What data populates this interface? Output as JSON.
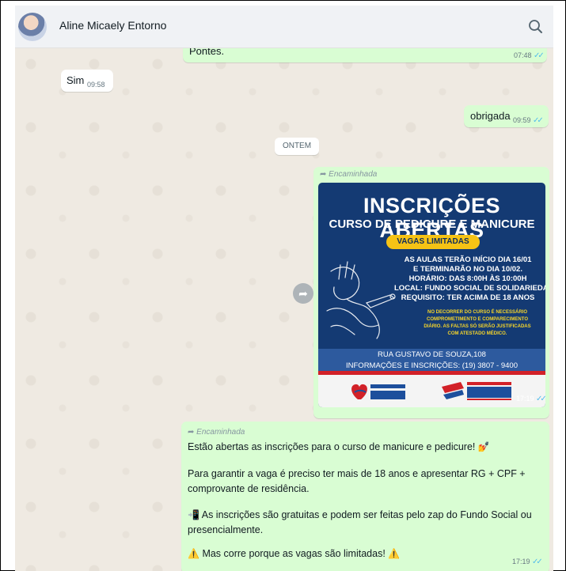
{
  "header": {
    "contact_name": "Aline Micaely Entorno"
  },
  "icons": {
    "avatar": "contact-avatar",
    "search": "search-icon",
    "forward": "forward-arrow-icon",
    "share": "share-icon",
    "ticks": "double-check-icon"
  },
  "colors": {
    "outgoing_bubble": "#d9fdd3",
    "incoming_bubble": "#ffffff",
    "chat_bg": "#efeae2",
    "read_ticks": "#53bdeb"
  },
  "messages": [
    {
      "direction": "out",
      "text": "Pontes.",
      "time": "07:48",
      "ticks": "✓✓"
    },
    {
      "direction": "in",
      "text": "Sim",
      "time": "09:58"
    },
    {
      "direction": "out",
      "text": "obrigada",
      "time": "09:59",
      "ticks": "✓✓"
    }
  ],
  "date_divider": "ONTEM",
  "forwarded_label": "Encaminhada",
  "poster": {
    "headline": "INSCRIÇÕES ABERTAS",
    "subheadline": "CURSO DE PEDICURE E MANICURE",
    "badge": "VAGAS LIMITADAS",
    "info_lines": [
      "AS AULAS TERÃO INÍCIO DIA 16/01",
      "E TERMINARÃO NO DIA 10/02.",
      "HORÁRIO: DAS 8:00H ÀS 10:00H",
      "LOCAL: FUNDO SOCIAL DE SOLIDARIEDADE",
      "REQUISITO: TER ACIMA DE 18 ANOS"
    ],
    "note_lines": [
      "NO DECORRER DO CURSO É NECESSÁRIO",
      "COMPROMETIMENTO E COMPARECIMENTO",
      "DIÁRIO. AS FALTAS SÓ SERÃO JUSTIFICADAS",
      "COM ATESTADO MÉDICO."
    ],
    "address": "RUA GUSTAVO DE SOUZA,108",
    "contact": "INFORMAÇÕES E INSCRIÇÕES: (19) 3807 - 9400",
    "logo_left": "FUNDO SOCIAL DE SOLIDARIEDADE AMPARO",
    "logo_right": "PREFEITURA DE AMPARO",
    "time": "17:19",
    "ticks": "✓✓"
  },
  "text_message": {
    "line1": "Estão abertas as inscrições para o curso de manicure e pedicure!",
    "emoji1": "💅",
    "line2": "Para garantir a vaga é preciso ter mais de 18 anos e apresentar RG + CPF +",
    "line3": "comprovante de residência.",
    "emoji2": "📲",
    "line4": "As inscrições são gratuitas e podem ser feitas pelo zap do Fundo Social ou",
    "line5": "presencialmente.",
    "warn_emoji": "⚠️",
    "line6": "Mas corre porque as vagas são limitadas!",
    "time": "17:19",
    "ticks": "✓✓"
  }
}
